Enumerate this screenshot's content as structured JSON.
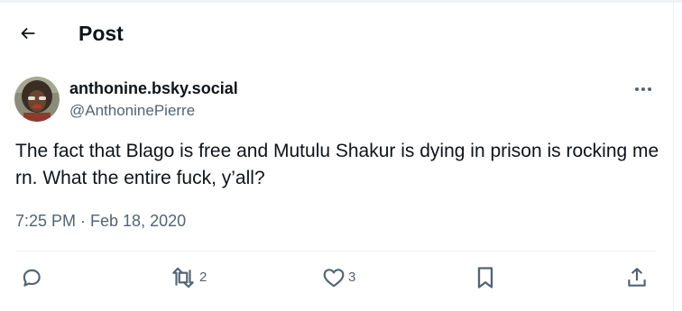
{
  "header": {
    "title": "Post"
  },
  "author": {
    "display_name": "anthonine.bsky.social",
    "handle": "@AnthoninePierre"
  },
  "post": {
    "text": "The fact that Blago is free and Mutulu Shakur is dying in prison is rocking me rn. What the entire fuck, y’all?",
    "timestamp": "7:25 PM · Feb 18, 2020"
  },
  "actions": {
    "reply_count": "",
    "repost_count": "2",
    "like_count": "3"
  },
  "icons": {
    "back": "arrow-left-icon",
    "more": "more-horizontal-icon",
    "reply": "reply-bubble-icon",
    "repost": "repost-icon",
    "like": "heart-icon",
    "bookmark": "bookmark-icon",
    "share": "share-upload-icon"
  }
}
